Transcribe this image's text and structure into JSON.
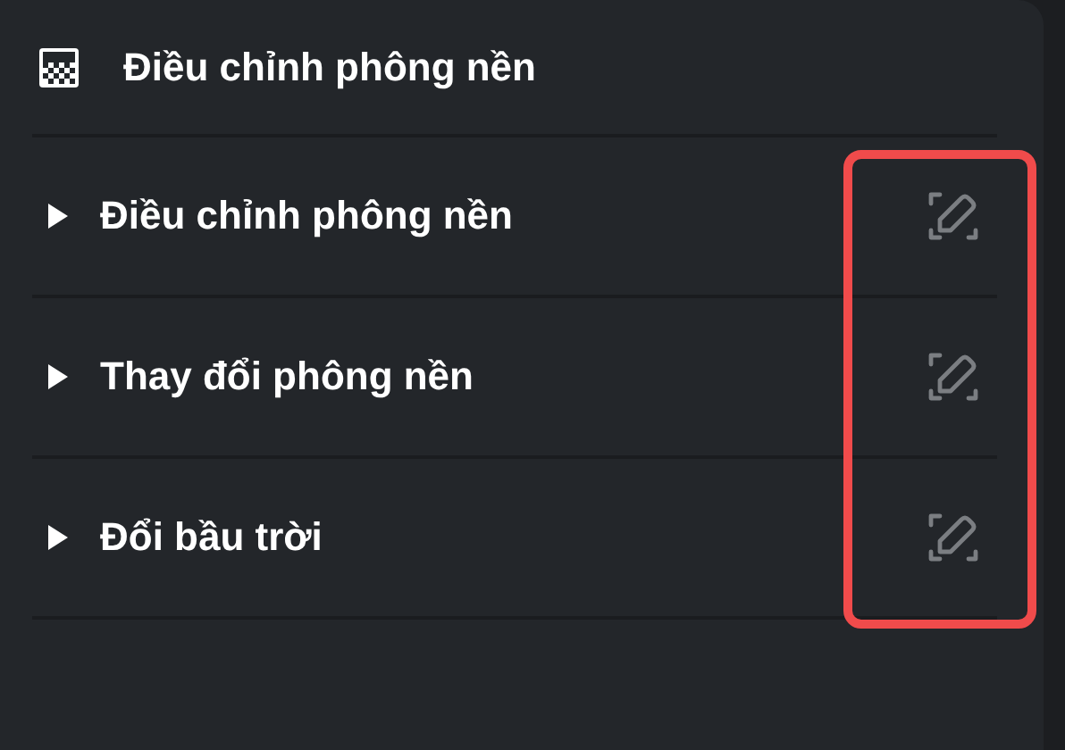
{
  "panel": {
    "title": "Điều chỉnh phông nền"
  },
  "items": [
    {
      "label": "Điều chỉnh phông nền",
      "expanded": false
    },
    {
      "label": "Thay đổi phông nền",
      "expanded": false
    },
    {
      "label": "Đổi bầu trời",
      "expanded": false
    }
  ],
  "highlight": {
    "color": "#f04b4b"
  }
}
